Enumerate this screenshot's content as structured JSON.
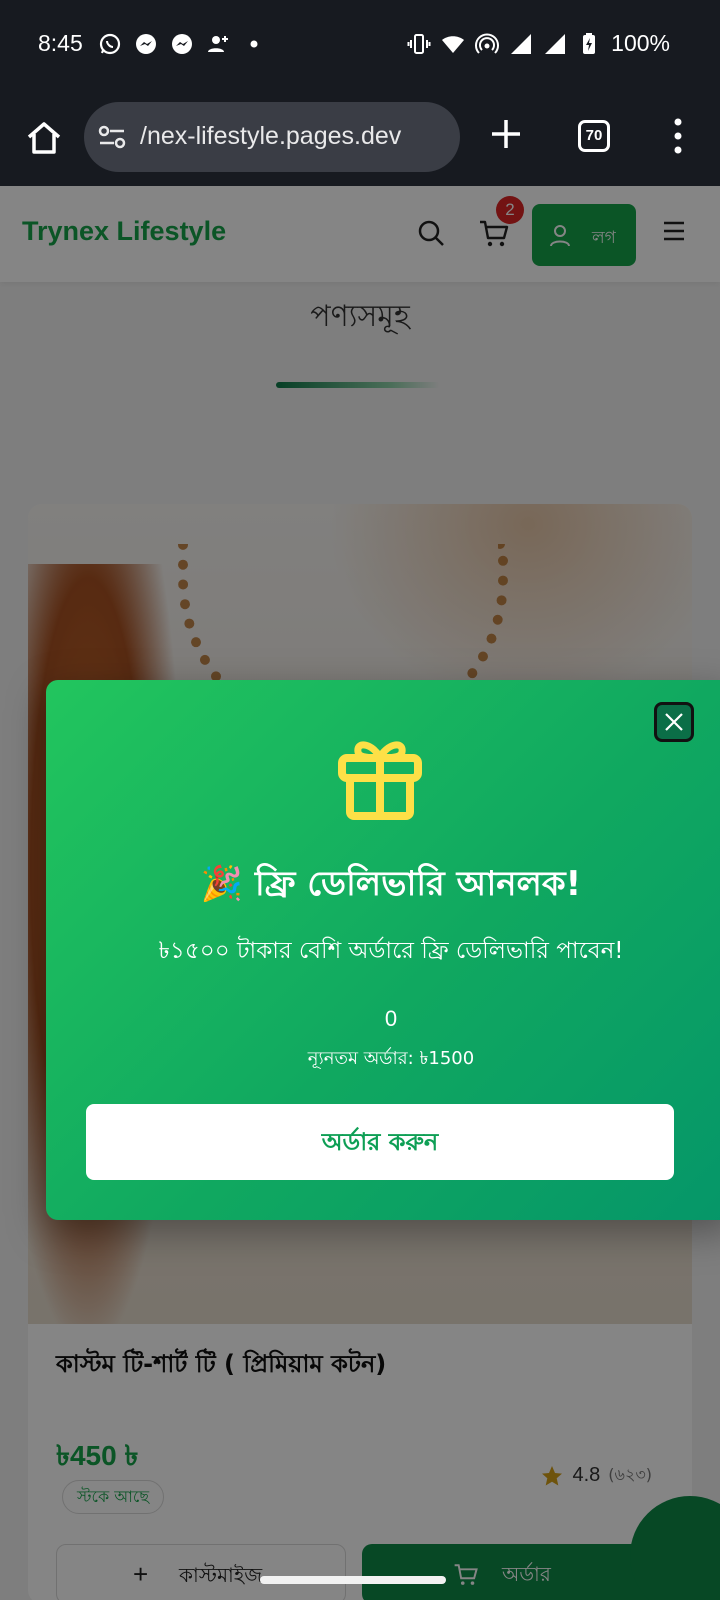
{
  "status_bar": {
    "time": "8:45",
    "battery_percent": "100%",
    "left_icons": [
      "whatsapp-icon",
      "messenger-icon",
      "messenger-icon",
      "add-user-icon",
      "dot-icon"
    ],
    "right_icons": [
      "vibrate-icon",
      "wifi-icon",
      "hotspot-icon",
      "signal-icon",
      "signal-icon",
      "battery-charging-icon"
    ]
  },
  "browser": {
    "url": "/nex-lifestyle.pages.dev",
    "tab_count": "70"
  },
  "site": {
    "brand": "Trynex Lifestyle",
    "cart_count": "2",
    "login_label": "লগ",
    "section_title": "পণ্যসমূহ"
  },
  "product": {
    "name": "কাস্টম টি-শার্ট টি ( প্রিমিয়াম কটন)",
    "price": "৳450 ৳",
    "stock": "স্টকে আছে",
    "rating": "4.8",
    "rating_count": "(৬২৩)",
    "customize_plus": "+",
    "customize_label": "কাস্টমাইজ",
    "order_label": "অর্ডার"
  },
  "modal": {
    "emoji": "🎉",
    "title": "ফ্রি ডেলিভারি আনলক!",
    "subtitle": "৳১৫০০ টাকার বেশি অর্ডারে ফ্রি ডেলিভারি পাবেন!",
    "count": "0",
    "minimum": "ন্যূনতম অর্ডার: ৳1500",
    "cta": "অর্ডার করুন"
  },
  "colors": {
    "brand_green": "#16a34a",
    "modal_gradient_start": "#22c55e",
    "modal_gradient_end": "#059669",
    "badge_red": "#dc2626",
    "gift_yellow": "#fde047",
    "star_gold": "#d4a017"
  }
}
